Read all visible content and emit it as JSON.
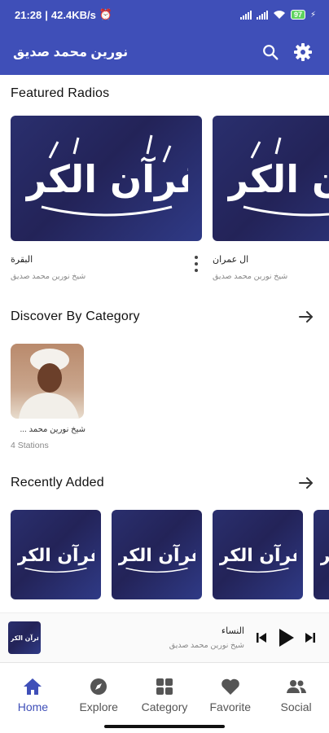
{
  "status": {
    "time": "21:28",
    "speed": "42.4KB/s",
    "battery": "97"
  },
  "appbar": {
    "title": "نورين محمد صديق",
    "search_icon": "search-icon",
    "settings_icon": "gear-icon"
  },
  "featured": {
    "title": "Featured Radios",
    "items": [
      {
        "name": "البقرة",
        "subtitle": "شيخ نورين محمد صديق"
      },
      {
        "name": "ال عمران",
        "subtitle": "شيخ نورين محمد صديق"
      }
    ]
  },
  "category": {
    "title": "Discover By Category",
    "items": [
      {
        "name": "شيخ نورين محمد ...",
        "count": "4 Stations"
      }
    ]
  },
  "recent": {
    "title": "Recently Added"
  },
  "artwork_text": "القرآن الكريم",
  "player": {
    "title": "النساء",
    "subtitle": "شيخ نورين محمد صديق"
  },
  "nav": {
    "items": [
      {
        "label": "Home",
        "icon": "home-icon"
      },
      {
        "label": "Explore",
        "icon": "compass-icon"
      },
      {
        "label": "Category",
        "icon": "grid-icon"
      },
      {
        "label": "Favorite",
        "icon": "heart-icon"
      },
      {
        "label": "Social",
        "icon": "people-icon"
      }
    ]
  },
  "colors": {
    "primary": "#3f4fb8",
    "artwork": "#2a2f6e"
  }
}
